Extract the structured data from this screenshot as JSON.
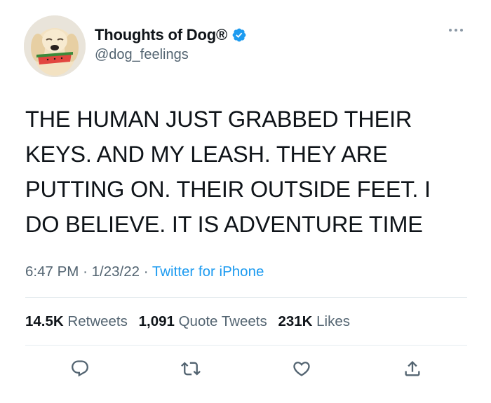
{
  "tweet": {
    "display_name": "Thoughts of Dog®",
    "handle": "@dog_feelings",
    "verified_icon": "verified-badge-icon",
    "more_icon": "more-options-icon",
    "text": "THE HUMAN JUST GRABBED THEIR\nKEYS. AND MY LEASH. THEY ARE\nPUTTING ON. THEIR OUTSIDE FEET. I\nDO BELIEVE. IT IS ADVENTURE TIME",
    "time": "6:47 PM",
    "date": "1/23/22",
    "separator": "·",
    "source": "Twitter for iPhone"
  },
  "stats": {
    "retweets_count": "14.5K",
    "retweets_label": "Retweets",
    "quotes_count": "1,091",
    "quotes_label": "Quote Tweets",
    "likes_count": "231K",
    "likes_label": "Likes"
  },
  "actions": {
    "reply_icon": "reply-icon",
    "retweet_icon": "retweet-icon",
    "like_icon": "heart-icon",
    "share_icon": "share-icon"
  },
  "colors": {
    "accent": "#1d9bf0",
    "text": "#0f1419",
    "secondary": "#536471",
    "divider": "#e6ecf0"
  }
}
